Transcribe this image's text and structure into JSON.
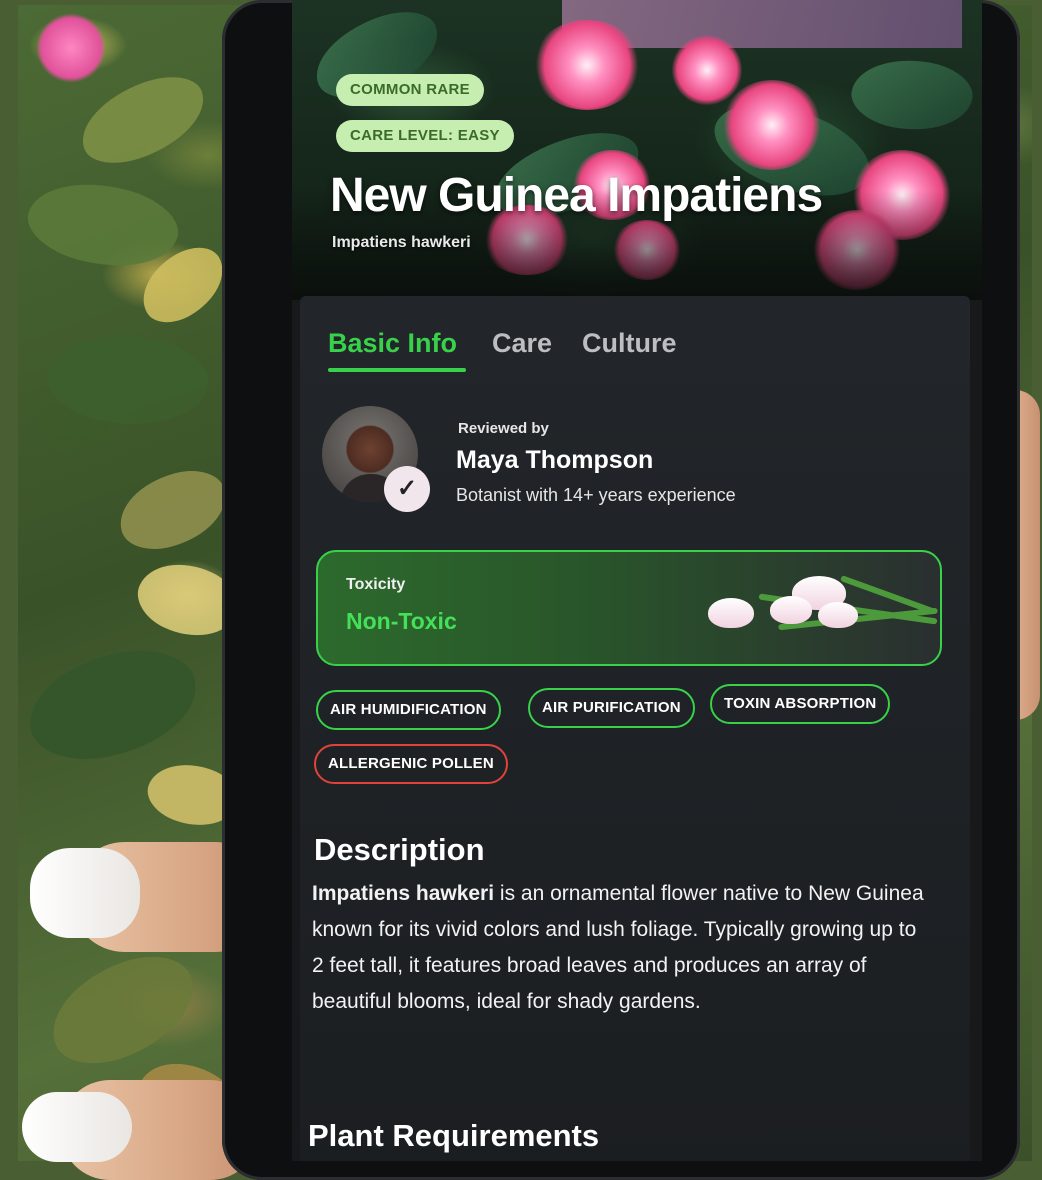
{
  "hero": {
    "badges": [
      "COMMON RARE",
      "CARE LEVEL: EASY"
    ],
    "title": "New Guinea Impatiens",
    "scientific_name": "Impatiens hawkeri"
  },
  "tabs": [
    {
      "label": "Basic Info",
      "active": true
    },
    {
      "label": "Care",
      "active": false
    },
    {
      "label": "Culture",
      "active": false
    }
  ],
  "reviewer": {
    "label": "Reviewed by",
    "name": "Maya Thompson",
    "description": "Botanist with 14+ years experience",
    "verified_icon": "checkmark-icon"
  },
  "toxicity": {
    "label": "Toxicity",
    "value": "Non-Toxic"
  },
  "traits": [
    {
      "label": "AIR HUMIDIFICATION",
      "status": "positive"
    },
    {
      "label": "AIR PURIFICATION",
      "status": "positive"
    },
    {
      "label": "TOXIN ABSORPTION",
      "status": "positive"
    },
    {
      "label": "ALLERGENIC POLLEN",
      "status": "negative"
    }
  ],
  "description": {
    "heading": "Description",
    "lead": "Impatiens hawkeri",
    "body": " is an ornamental flower native to New Guinea known for its vivid colors and lush foliage. Typically growing up to 2 feet tall, it features broad leaves and produces an array of beautiful blooms, ideal for shady gardens."
  },
  "requirements": {
    "heading": "Plant Requirements"
  },
  "colors": {
    "accent": "#38d24a",
    "warning": "#e0433b",
    "badge_bg": "#c6eeb0",
    "card_bg": "#22262a"
  }
}
